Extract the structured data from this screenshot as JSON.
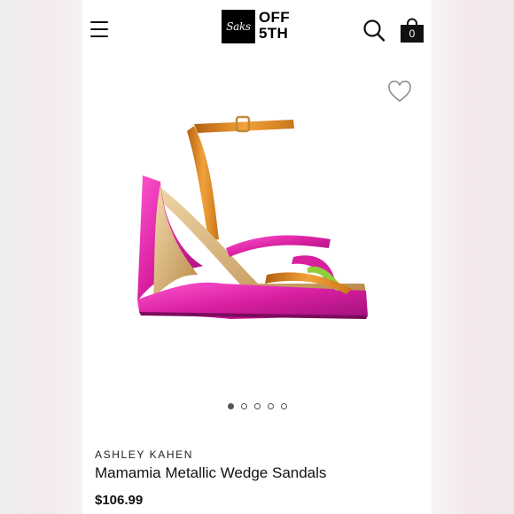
{
  "header": {
    "logo": {
      "script": "Saks",
      "text_line1": "OFF",
      "text_line2": "5TH"
    },
    "cart_count": "0"
  },
  "icons": {
    "menu": "hamburger-menu-icon",
    "search": "search-icon",
    "bag": "shopping-bag-icon",
    "wishlist": "heart-icon"
  },
  "gallery": {
    "slides": 5,
    "active_index": 0
  },
  "product": {
    "brand": "ASHLEY KAHEN",
    "name": "Mamamia Metallic Wedge Sandals",
    "price": "$106.99"
  },
  "colors": {
    "fuchsia": "#d81fa0",
    "orange": "#e08a1e",
    "green": "#8fcf3a",
    "gold": "#d9b57a"
  }
}
